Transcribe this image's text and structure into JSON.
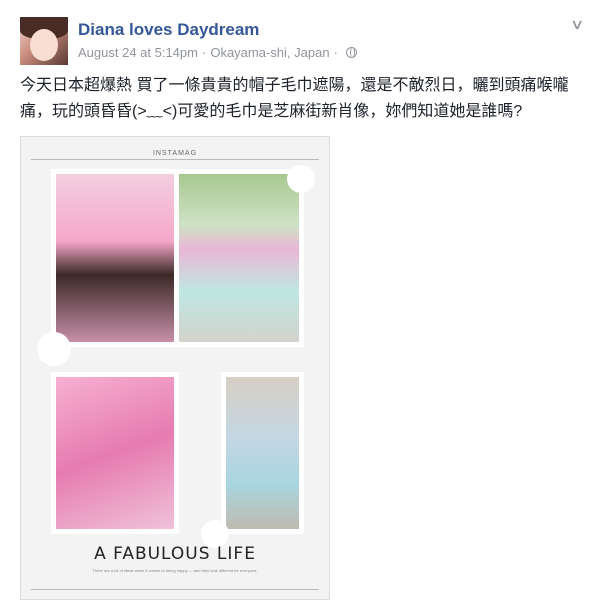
{
  "post": {
    "author": "Diana loves Daydream",
    "timestamp": "August 24 at 5:14pm",
    "location": "Okayama-shi, Japan",
    "separator": "·",
    "text": "今天日本超爆熱 買了一條貴貴的帽子毛巾遮陽，還是不敵烈日，曬到頭痛喉嚨痛，玩的頭昏昏(>﹏<)可愛的毛巾是芝麻街新肖像，妳們知道她是誰嗎?"
  },
  "collage": {
    "header": "INSTAMAG",
    "title": "A FABULOUS LIFE",
    "caption": "There are a lot of ideas when it comes to being happy — and they look different for everyone."
  },
  "icons": {
    "menu": "chevron-down-icon",
    "audience": "globe-icon"
  }
}
